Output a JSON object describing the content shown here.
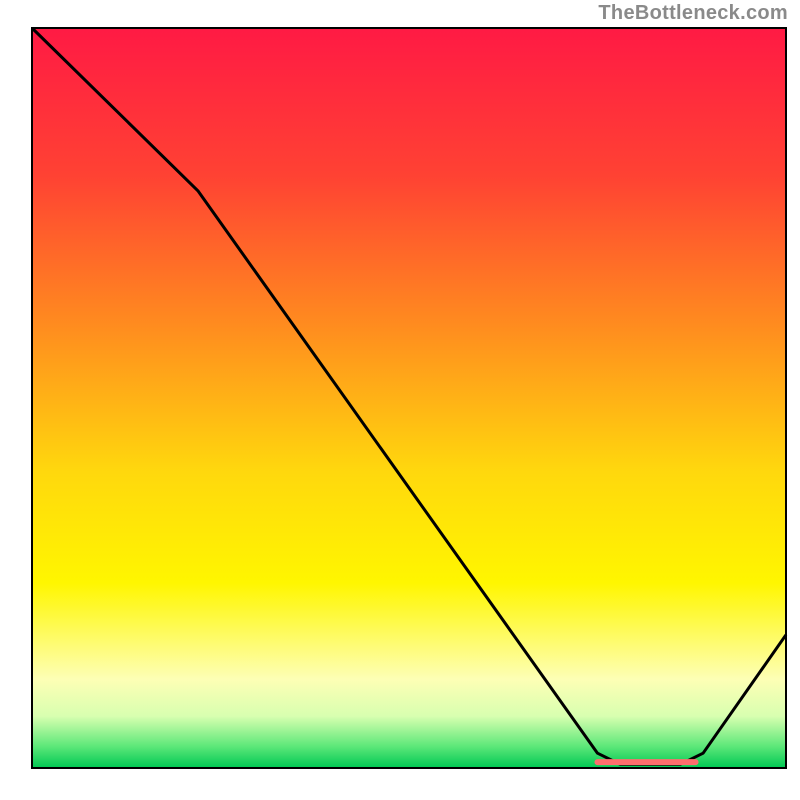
{
  "attribution": "TheBottleneck.com",
  "chart_data": {
    "type": "line",
    "title": "",
    "xlabel": "",
    "ylabel": "",
    "xlim": [
      0,
      100
    ],
    "ylim": [
      0,
      100
    ],
    "grid": false,
    "legend": false,
    "gradient_stops": [
      {
        "offset": 0.0,
        "color": "#ff1a44"
      },
      {
        "offset": 0.2,
        "color": "#ff4233"
      },
      {
        "offset": 0.4,
        "color": "#ff8b1f"
      },
      {
        "offset": 0.6,
        "color": "#ffd80d"
      },
      {
        "offset": 0.75,
        "color": "#fff600"
      },
      {
        "offset": 0.88,
        "color": "#fdffb5"
      },
      {
        "offset": 0.93,
        "color": "#d8ffb0"
      },
      {
        "offset": 0.97,
        "color": "#5fe87a"
      },
      {
        "offset": 1.0,
        "color": "#00c853"
      }
    ],
    "series": [
      {
        "name": "bottleneck-curve",
        "color": "#000000",
        "points": [
          {
            "x": 0.0,
            "y": 100.0
          },
          {
            "x": 22.0,
            "y": 78.0
          },
          {
            "x": 75.0,
            "y": 2.0
          },
          {
            "x": 78.0,
            "y": 0.5
          },
          {
            "x": 86.0,
            "y": 0.5
          },
          {
            "x": 89.0,
            "y": 2.0
          },
          {
            "x": 100.0,
            "y": 18.0
          }
        ]
      }
    ],
    "marker_band": {
      "color": "#ff6d6d",
      "x_start": 75.0,
      "x_end": 88.0,
      "y": 0.8,
      "thickness_px": 6
    }
  }
}
